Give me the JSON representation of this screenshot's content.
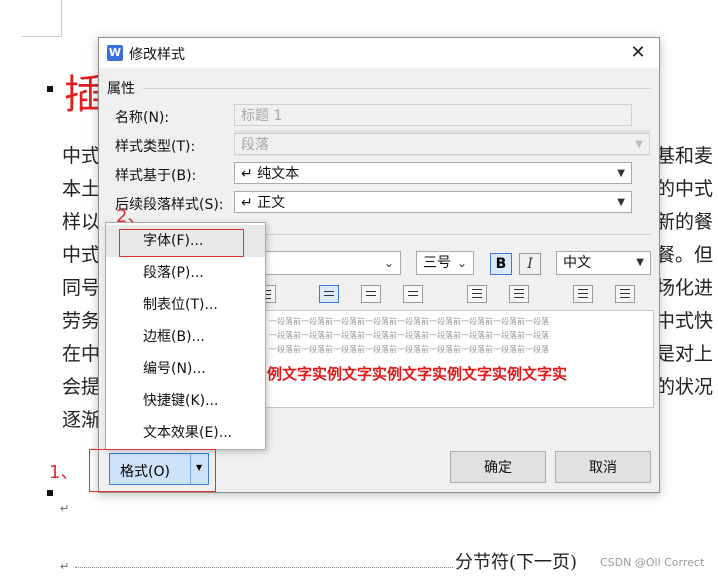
{
  "document": {
    "heading_char": "插",
    "left_lines": [
      "中式",
      "本土",
      "样以",
      "中式",
      "同号",
      "劳务",
      "在中",
      "会提",
      "逐渐"
    ],
    "right_lines": [
      "基和麦",
      "的中式",
      "新的餐",
      "餐。但",
      "场化进",
      "中式快",
      "是对上",
      "的状况"
    ],
    "section_break": "分节符(下一页)",
    "para_mark": "↵",
    "watermark": "CSDN @Oll Correct"
  },
  "dialog": {
    "title": "修改样式",
    "app_icon": "W",
    "close_glyph": "✕",
    "group_label": "属性",
    "fields": [
      {
        "label": "名称(N):",
        "value": "标题 1",
        "disabled": true
      },
      {
        "label": "样式类型(T):",
        "value": "段落",
        "disabled": true
      },
      {
        "label": "样式基于(B):",
        "value": "↵ 纯文本",
        "disabled": false
      },
      {
        "label": "后续段落样式(S):",
        "value": "↵ 正文",
        "disabled": false
      }
    ],
    "font_size": "三号",
    "bold_label": "B",
    "italic_label": "I",
    "script": "中文",
    "preview": {
      "prev_line": "一段落前一段落前一段落前一段落前一段落前一段落前一段落前一段落前一段落",
      "sample": "例文字实例文字实例文字实例文字实例文字实"
    },
    "format_button": "格式(O)",
    "ok_button": "确定",
    "cancel_button": "取消"
  },
  "menu": {
    "items": [
      "字体(F)...",
      "段落(P)...",
      "制表位(T)...",
      "边框(B)...",
      "编号(N)...",
      "快捷键(K)...",
      "文本效果(E)..."
    ]
  },
  "annotations": {
    "step1": "1、",
    "step2": "2、"
  },
  "colors": {
    "accent": "#3c7fd6",
    "annotation": "#e03030",
    "sample_text": "#e01a1a"
  }
}
